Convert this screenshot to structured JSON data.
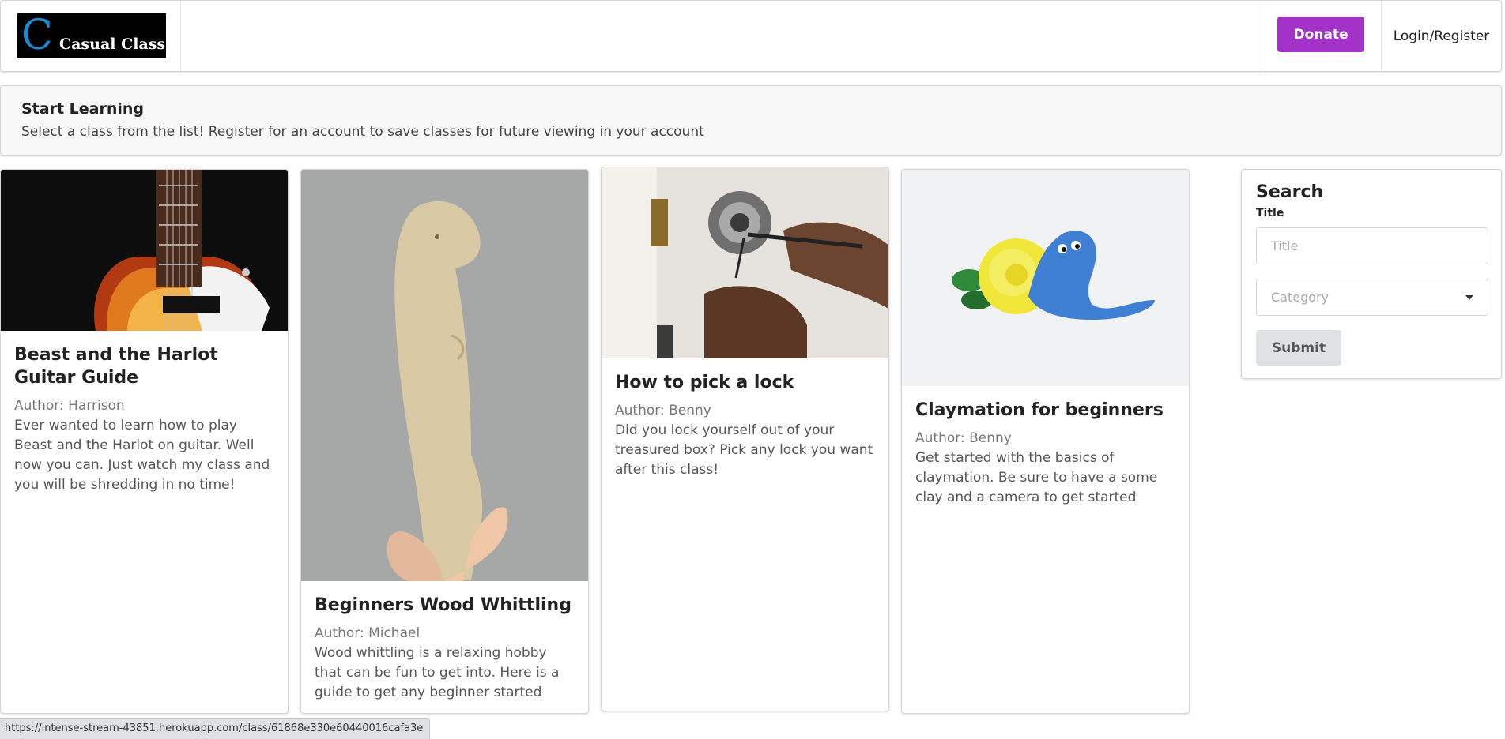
{
  "navbar": {
    "logo_letter": "C",
    "logo_text": "Casual Class",
    "donate_label": "Donate",
    "login_label": "Login/Register",
    "colors": {
      "donate": "#a333c8",
      "logo_c": "#1d8ad1"
    }
  },
  "intro": {
    "header": "Start Learning",
    "body": "Select a class from the list! Register for an account to save classes for future viewing in your account"
  },
  "classes": [
    {
      "title": "Beast and the Harlot Guitar Guide",
      "author": "Author: Harrison",
      "description": "Ever wanted to learn how to play Beast and the Harlot on guitar. Well now you can. Just watch my class and you will be shredding in no time!"
    },
    {
      "title": "Beginners Wood Whittling",
      "author": "Author: Michael",
      "description": "Wood whittling is a relaxing hobby that can be fun to get into. Here is a guide to get any beginner started"
    },
    {
      "title": "How to pick a lock",
      "author": "Author: Benny",
      "description": "Did you lock yourself out of your treasured box? Pick any lock you want after this class!"
    },
    {
      "title": "Claymation for beginners",
      "author": "Author: Benny",
      "description": "Get started with the basics of claymation. Be sure to have a some clay and a camera to get started"
    }
  ],
  "search": {
    "title": "Search",
    "title_label": "Title",
    "title_placeholder": "Title",
    "category_placeholder": "Category",
    "submit_label": "Submit"
  },
  "status_url": "https://intense-stream-43851.herokuapp.com/class/61868e330e60440016cafa3e"
}
